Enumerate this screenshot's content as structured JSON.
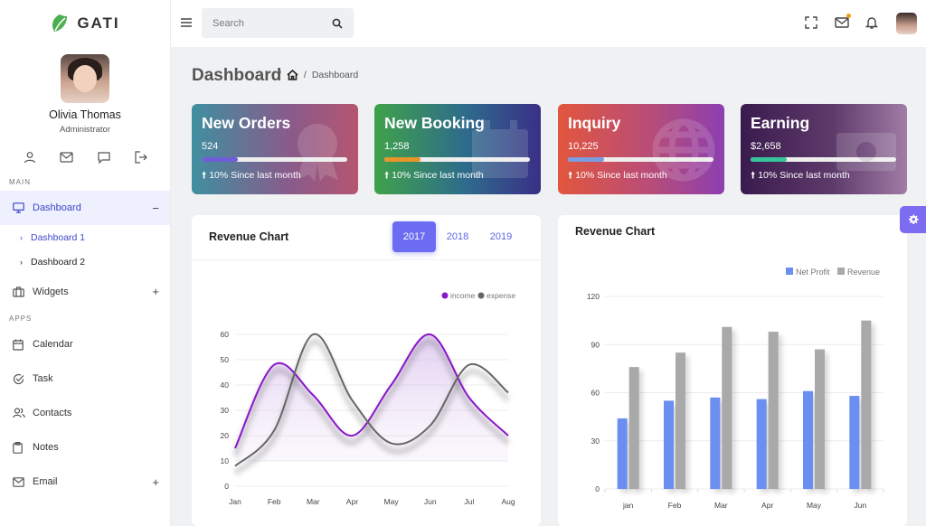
{
  "brand": {
    "name": "GATI"
  },
  "profile": {
    "name": "Olivia Thomas",
    "role": "Administrator"
  },
  "profile_actions": [
    "user-icon",
    "mail-icon",
    "chat-icon",
    "logout-icon"
  ],
  "sidebar": {
    "sections": [
      {
        "label": "MAIN",
        "items": [
          {
            "label": "Dashboard",
            "icon": "monitor-icon",
            "suffix": "−",
            "active": true,
            "children": [
              {
                "label": "Dashboard 1",
                "active": true
              },
              {
                "label": "Dashboard 2",
                "active": false
              }
            ]
          },
          {
            "label": "Widgets",
            "icon": "briefcase-icon",
            "suffix": "+"
          }
        ]
      },
      {
        "label": "APPS",
        "items": [
          {
            "label": "Calendar",
            "icon": "calendar-icon"
          },
          {
            "label": "Task",
            "icon": "check-circle-icon"
          },
          {
            "label": "Contacts",
            "icon": "users-icon"
          },
          {
            "label": "Notes",
            "icon": "clipboard-icon"
          },
          {
            "label": "Email",
            "icon": "mail-icon",
            "suffix": "+"
          }
        ]
      }
    ]
  },
  "header": {
    "search_placeholder": "Search"
  },
  "page": {
    "title": "Dashboard",
    "breadcrumb_sep": "/",
    "breadcrumb_current": "Dashboard"
  },
  "stats": [
    {
      "title": "New Orders",
      "value": "524",
      "progress": 0.25,
      "note": "10% Since last month",
      "fill": "#6f5cd8",
      "gradient": "linear-gradient(90deg,#3f8fa0 0%,#8a5a8a 60%,#b55670 100%)"
    },
    {
      "title": "New Booking",
      "value": "1,258",
      "progress": 0.25,
      "note": "10% Since last month",
      "fill": "#e8962a",
      "gradient": "linear-gradient(90deg,#3fa24a 0%,#2e6b8c 55%,#3a2f86 100%)"
    },
    {
      "title": "Inquiry",
      "value": "10,225",
      "progress": 0.25,
      "note": "10% Since last month",
      "fill": "#7a9ce0",
      "gradient": "linear-gradient(90deg,#e2563d 0%,#b84d78 55%,#8c3fb0 100%)"
    },
    {
      "title": "Earning",
      "value": "$2,658",
      "progress": 0.25,
      "note": "10% Since last month",
      "fill": "#36c49a",
      "gradient": "linear-gradient(90deg,#3a1b4e 0%,#5d3a6a 55%,#a07ca6 100%)"
    }
  ],
  "revenue_line": {
    "title": "Revenue Chart",
    "tabs": [
      {
        "label": "2017",
        "active": true
      },
      {
        "label": "2018"
      },
      {
        "label": "2019"
      }
    ]
  },
  "revenue_bar": {
    "title": "Revenue Chart"
  },
  "chart_data": [
    {
      "type": "line",
      "title": "Revenue Chart",
      "categories": [
        "Jan",
        "Feb",
        "Mar",
        "Apr",
        "May",
        "Jun",
        "Jul",
        "Aug"
      ],
      "ylim": [
        0,
        60
      ],
      "yticks": [
        0,
        10,
        20,
        30,
        40,
        50,
        60
      ],
      "legend_position": "top-right",
      "series": [
        {
          "name": "income",
          "color": "#8a16c9",
          "values": [
            15,
            48,
            36,
            20,
            40,
            60,
            35,
            20
          ]
        },
        {
          "name": "expense",
          "color": "#666666",
          "values": [
            8,
            22,
            60,
            34,
            17,
            24,
            48,
            37
          ]
        }
      ]
    },
    {
      "type": "bar",
      "title": "Revenue Chart",
      "categories": [
        "jan",
        "Feb",
        "Mar",
        "Apr",
        "May",
        "Jun"
      ],
      "ylim": [
        0,
        120
      ],
      "yticks": [
        0,
        30,
        60,
        90,
        120
      ],
      "legend_position": "top-right",
      "series": [
        {
          "name": "Net Profit",
          "color": "#6b8ff0",
          "values": [
            44,
            55,
            57,
            56,
            61,
            58
          ]
        },
        {
          "name": "Revenue",
          "color": "#a9a9a9",
          "values": [
            76,
            85,
            101,
            98,
            87,
            105
          ]
        }
      ]
    }
  ]
}
